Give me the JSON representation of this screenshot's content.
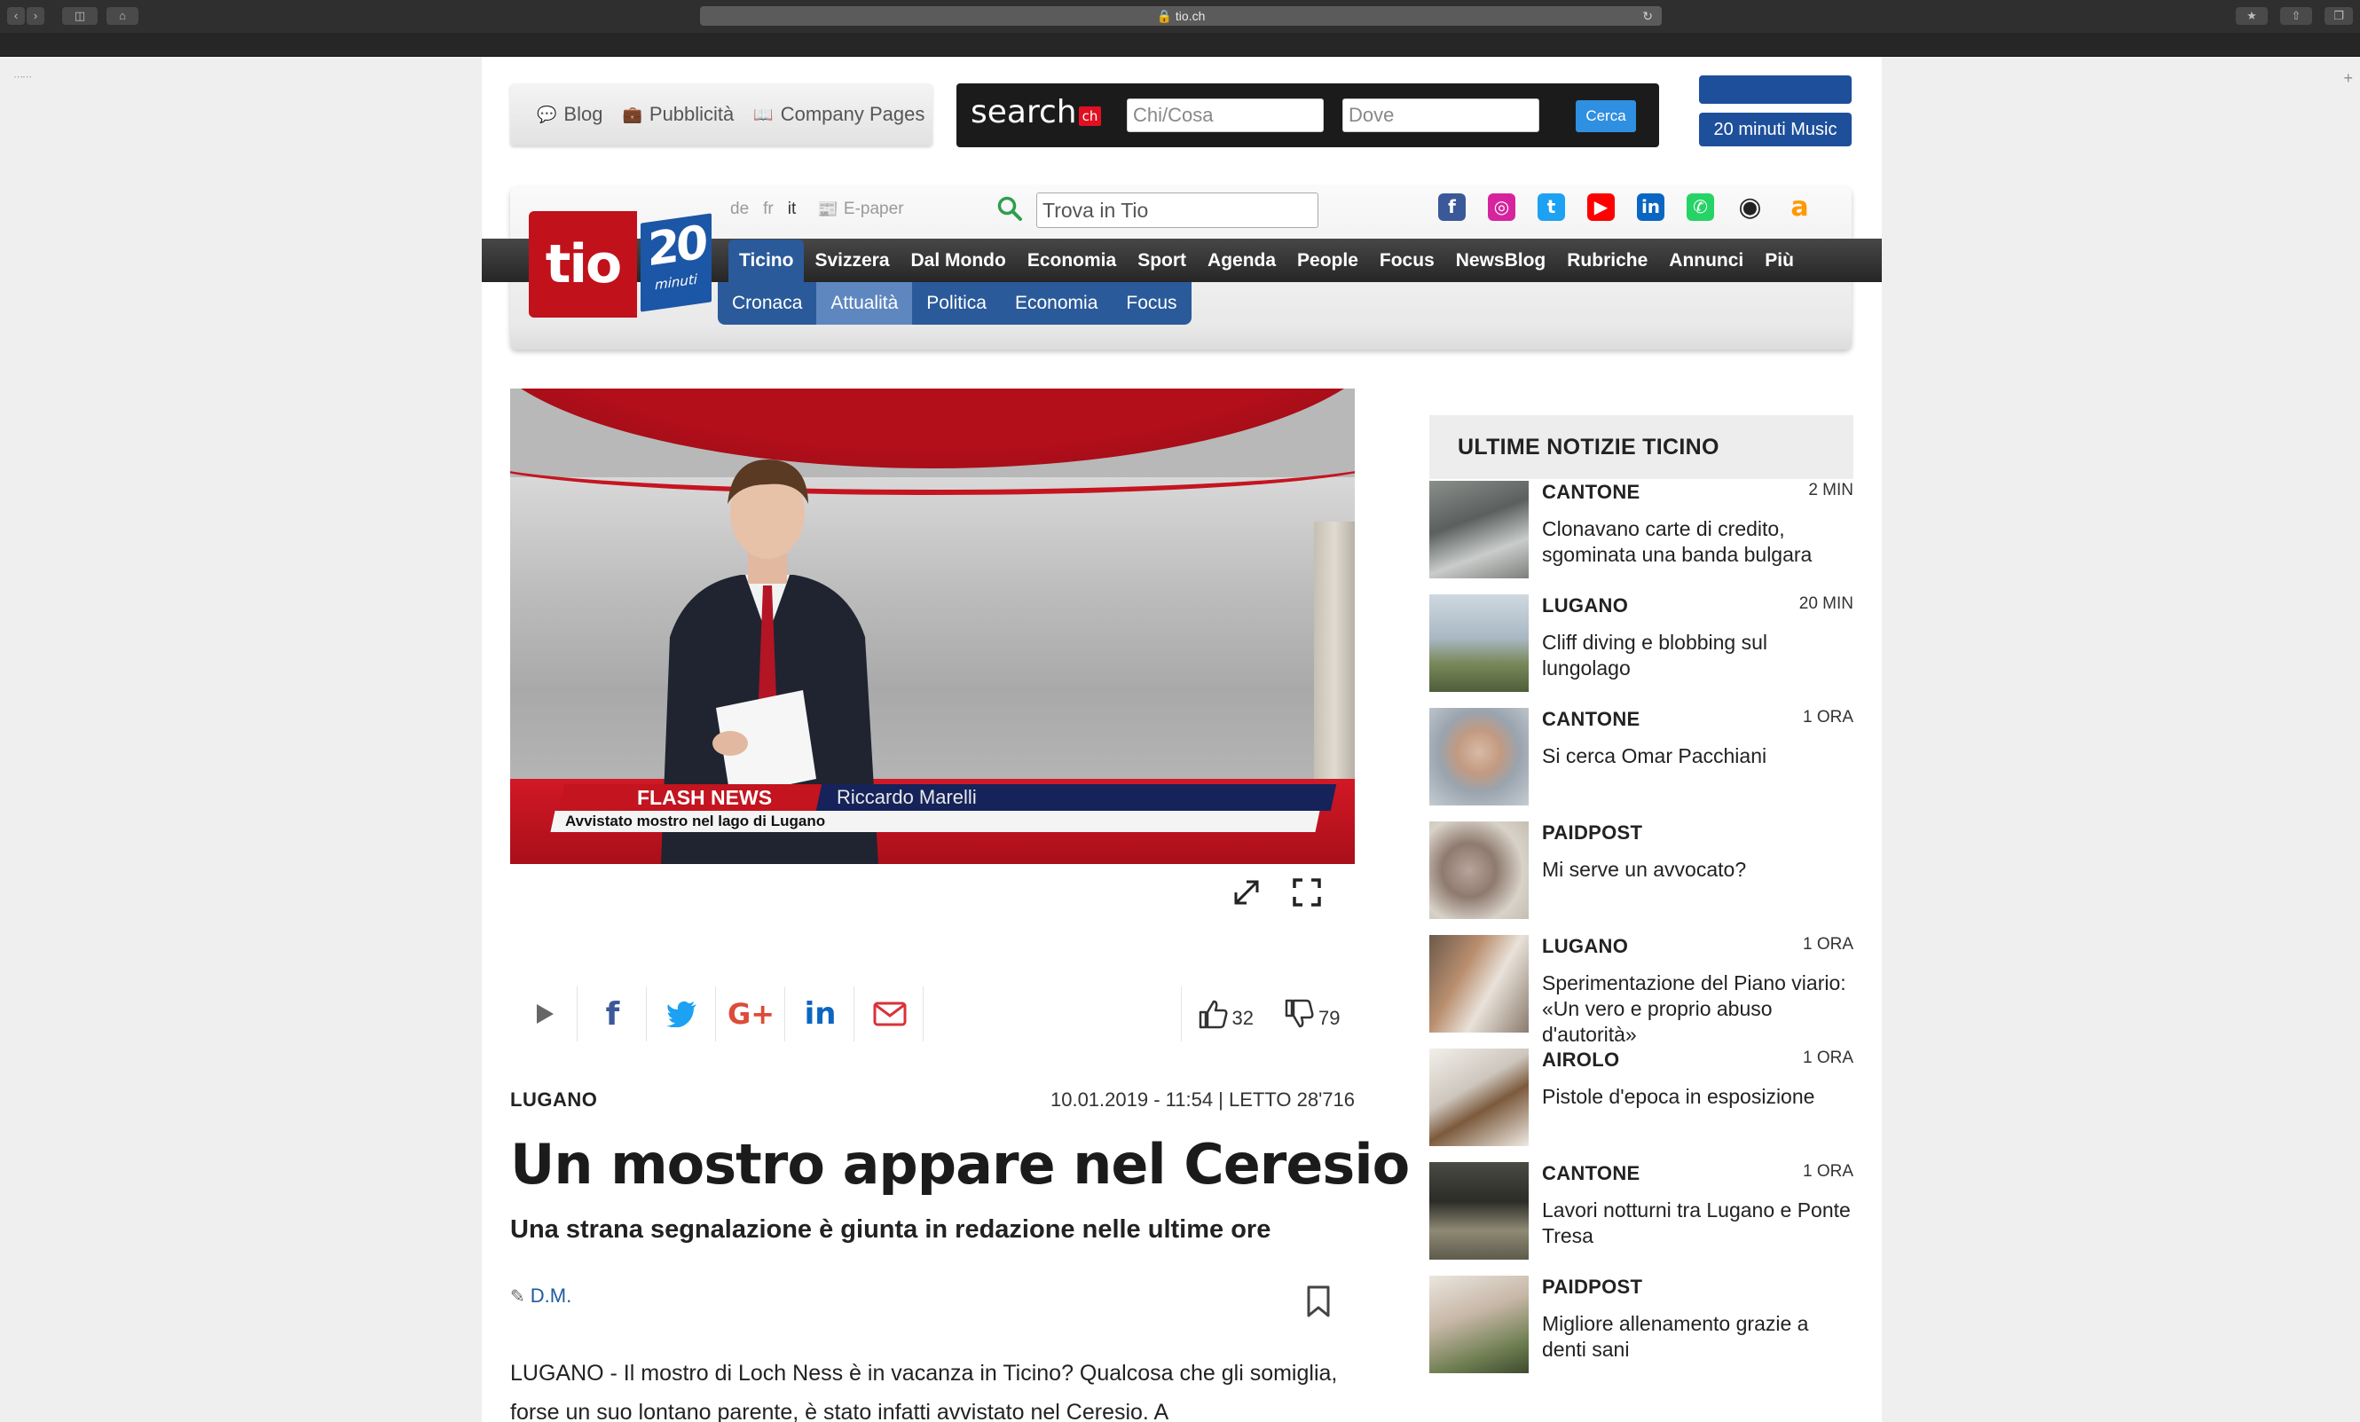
{
  "browser": {
    "url": "tio.ch"
  },
  "utility": {
    "blog": "Blog",
    "pubblicita": "Pubblicità",
    "company_pages": "Company Pages"
  },
  "searchch": {
    "logo": "search",
    "logo_suffix": "ch",
    "what_placeholder": "Chi/Cosa",
    "where_placeholder": "Dove",
    "button": "Cerca"
  },
  "promo": {
    "music": "20 minuti Music"
  },
  "logo": {
    "tio": "tio",
    "number": "20",
    "minuti": "minuti"
  },
  "languages": [
    "de",
    "fr",
    "it"
  ],
  "active_language": "it",
  "epaper": "E-paper",
  "site_search": {
    "placeholder": "Trova in Tio"
  },
  "social": [
    {
      "name": "facebook-icon",
      "color": "#3b5998",
      "glyph": "f"
    },
    {
      "name": "instagram-icon",
      "color": "#d6249f",
      "glyph": "◎"
    },
    {
      "name": "twitter-icon",
      "color": "#1da1f2",
      "glyph": "t"
    },
    {
      "name": "youtube-icon",
      "color": "#ff0000",
      "glyph": "▶"
    },
    {
      "name": "linkedin-icon",
      "color": "#0a66c2",
      "glyph": "in"
    },
    {
      "name": "whatsapp-icon",
      "color": "#25d366",
      "glyph": "✆"
    },
    {
      "name": "podcast-icon",
      "color": "#222222",
      "glyph": "◉"
    },
    {
      "name": "amazon-icon",
      "color": "#ff9900",
      "glyph": "a"
    }
  ],
  "nav": {
    "items": [
      "Ticino",
      "Svizzera",
      "Dal Mondo",
      "Economia",
      "Sport",
      "Agenda",
      "People",
      "Focus",
      "NewsBlog",
      "Rubriche",
      "Annunci",
      "Più"
    ],
    "active": "Ticino",
    "sub_items": [
      "Cronaca",
      "Attualità",
      "Politica",
      "Economia",
      "Focus"
    ],
    "sub_active": "Attualità"
  },
  "video": {
    "label": "FLASH NEWS",
    "name": "Riccardo Marelli",
    "subtitle": "Avvistato mostro nel lago di Lugano"
  },
  "votes": {
    "up": "32",
    "down": "79"
  },
  "article": {
    "location": "LUGANO",
    "meta": "10.01.2019 - 11:54 | LETTO 28'716",
    "title": "Un mostro appare nel Ceresio",
    "subtitle": "Una strana segnalazione è giunta in redazione nelle ultime ore",
    "author": "D.M.",
    "body": "LUGANO - Il mostro di Loch Ness è in vacanza in Ticino? Qualcosa che gli somiglia, forse un suo lontano parente, è stato infatti avvistato nel Ceresio. A"
  },
  "sidebar": {
    "heading": "ULTIME NOTIZIE TICINO",
    "items": [
      {
        "category": "CANTONE",
        "time": "2 MIN",
        "title": "Clonavano carte di credito, sgominata una banda bulgara"
      },
      {
        "category": "LUGANO",
        "time": "20 MIN",
        "title": "Cliff diving e blobbing sul lungolago"
      },
      {
        "category": "CANTONE",
        "time": "1 ORA",
        "title": "Si cerca Omar Pacchiani"
      },
      {
        "category": "PAIDPOST",
        "time": "",
        "title": "Mi serve un avvocato?"
      },
      {
        "category": "LUGANO",
        "time": "1 ORA",
        "title": "Sperimentazione del Piano viario: «Un vero e proprio abuso d'autorità»"
      },
      {
        "category": "AIROLO",
        "time": "1 ORA",
        "title": "Pistole d'epoca in esposizione"
      },
      {
        "category": "CANTONE",
        "time": "1 ORA",
        "title": "Lavori notturni tra Lugano e Ponte Tresa"
      },
      {
        "category": "PAIDPOST",
        "time": "",
        "title": "Migliore allenamento grazie a denti sani"
      }
    ]
  }
}
